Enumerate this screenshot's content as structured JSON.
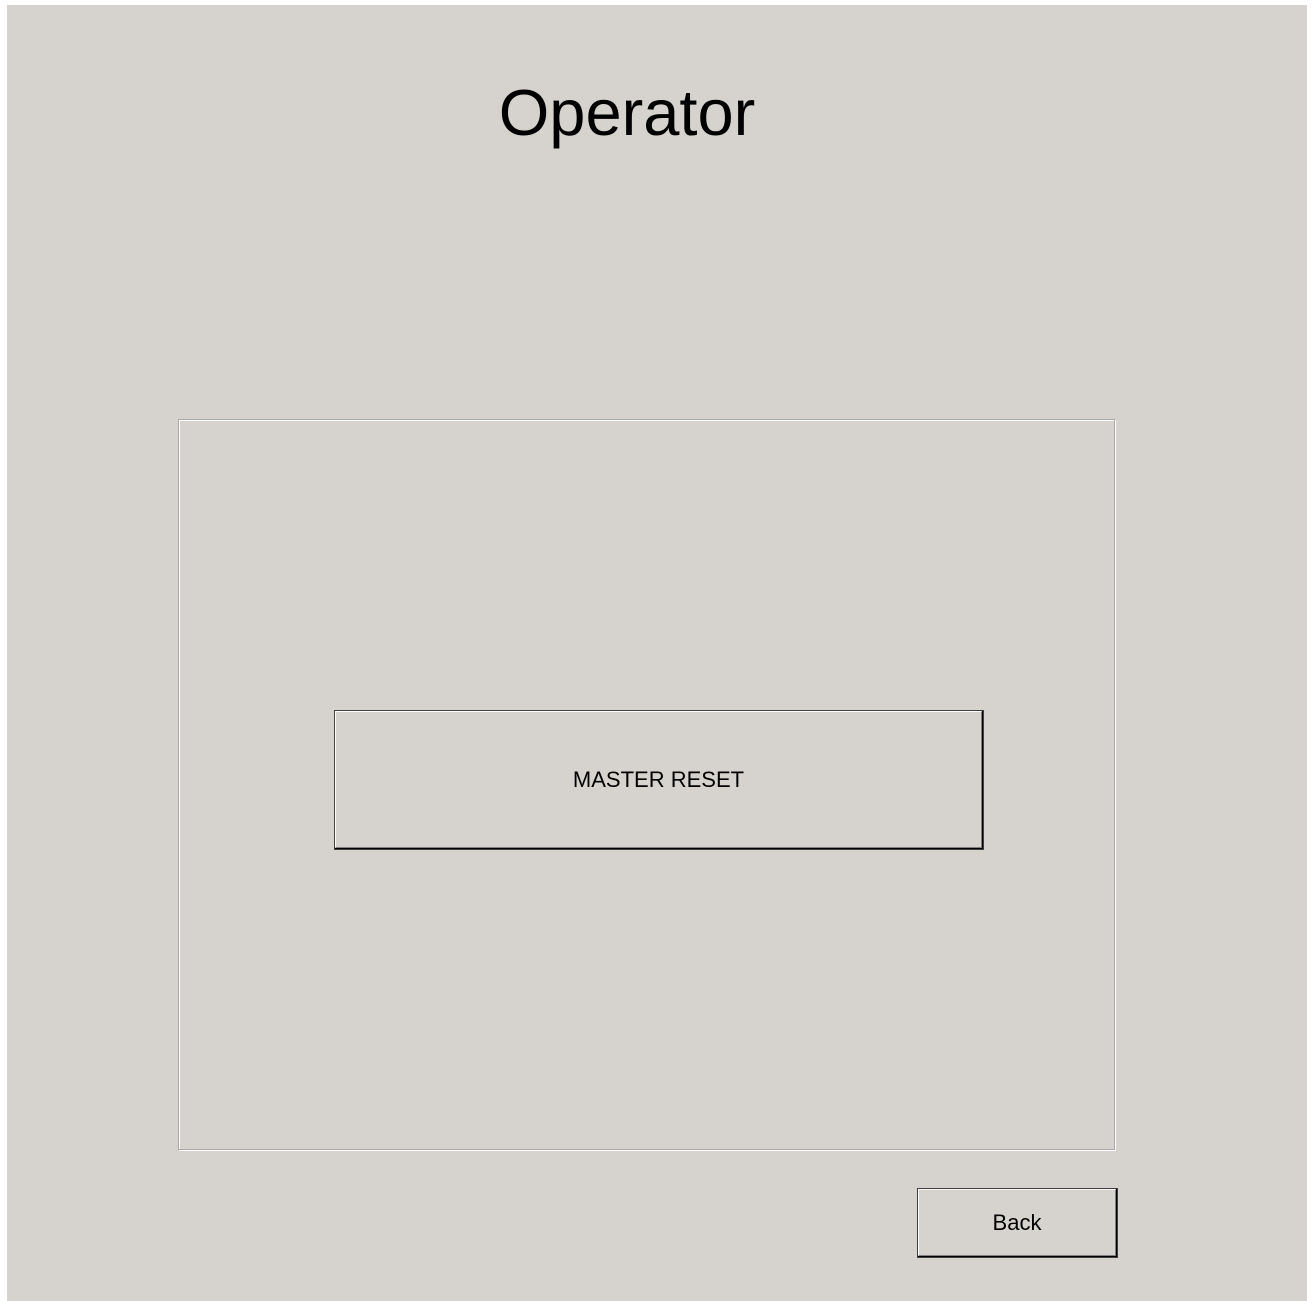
{
  "screen": {
    "title": "Operator",
    "background_color": "#d6d3ce"
  },
  "panel": {
    "master_reset_label": "MASTER RESET"
  },
  "footer": {
    "back_label": "Back"
  }
}
